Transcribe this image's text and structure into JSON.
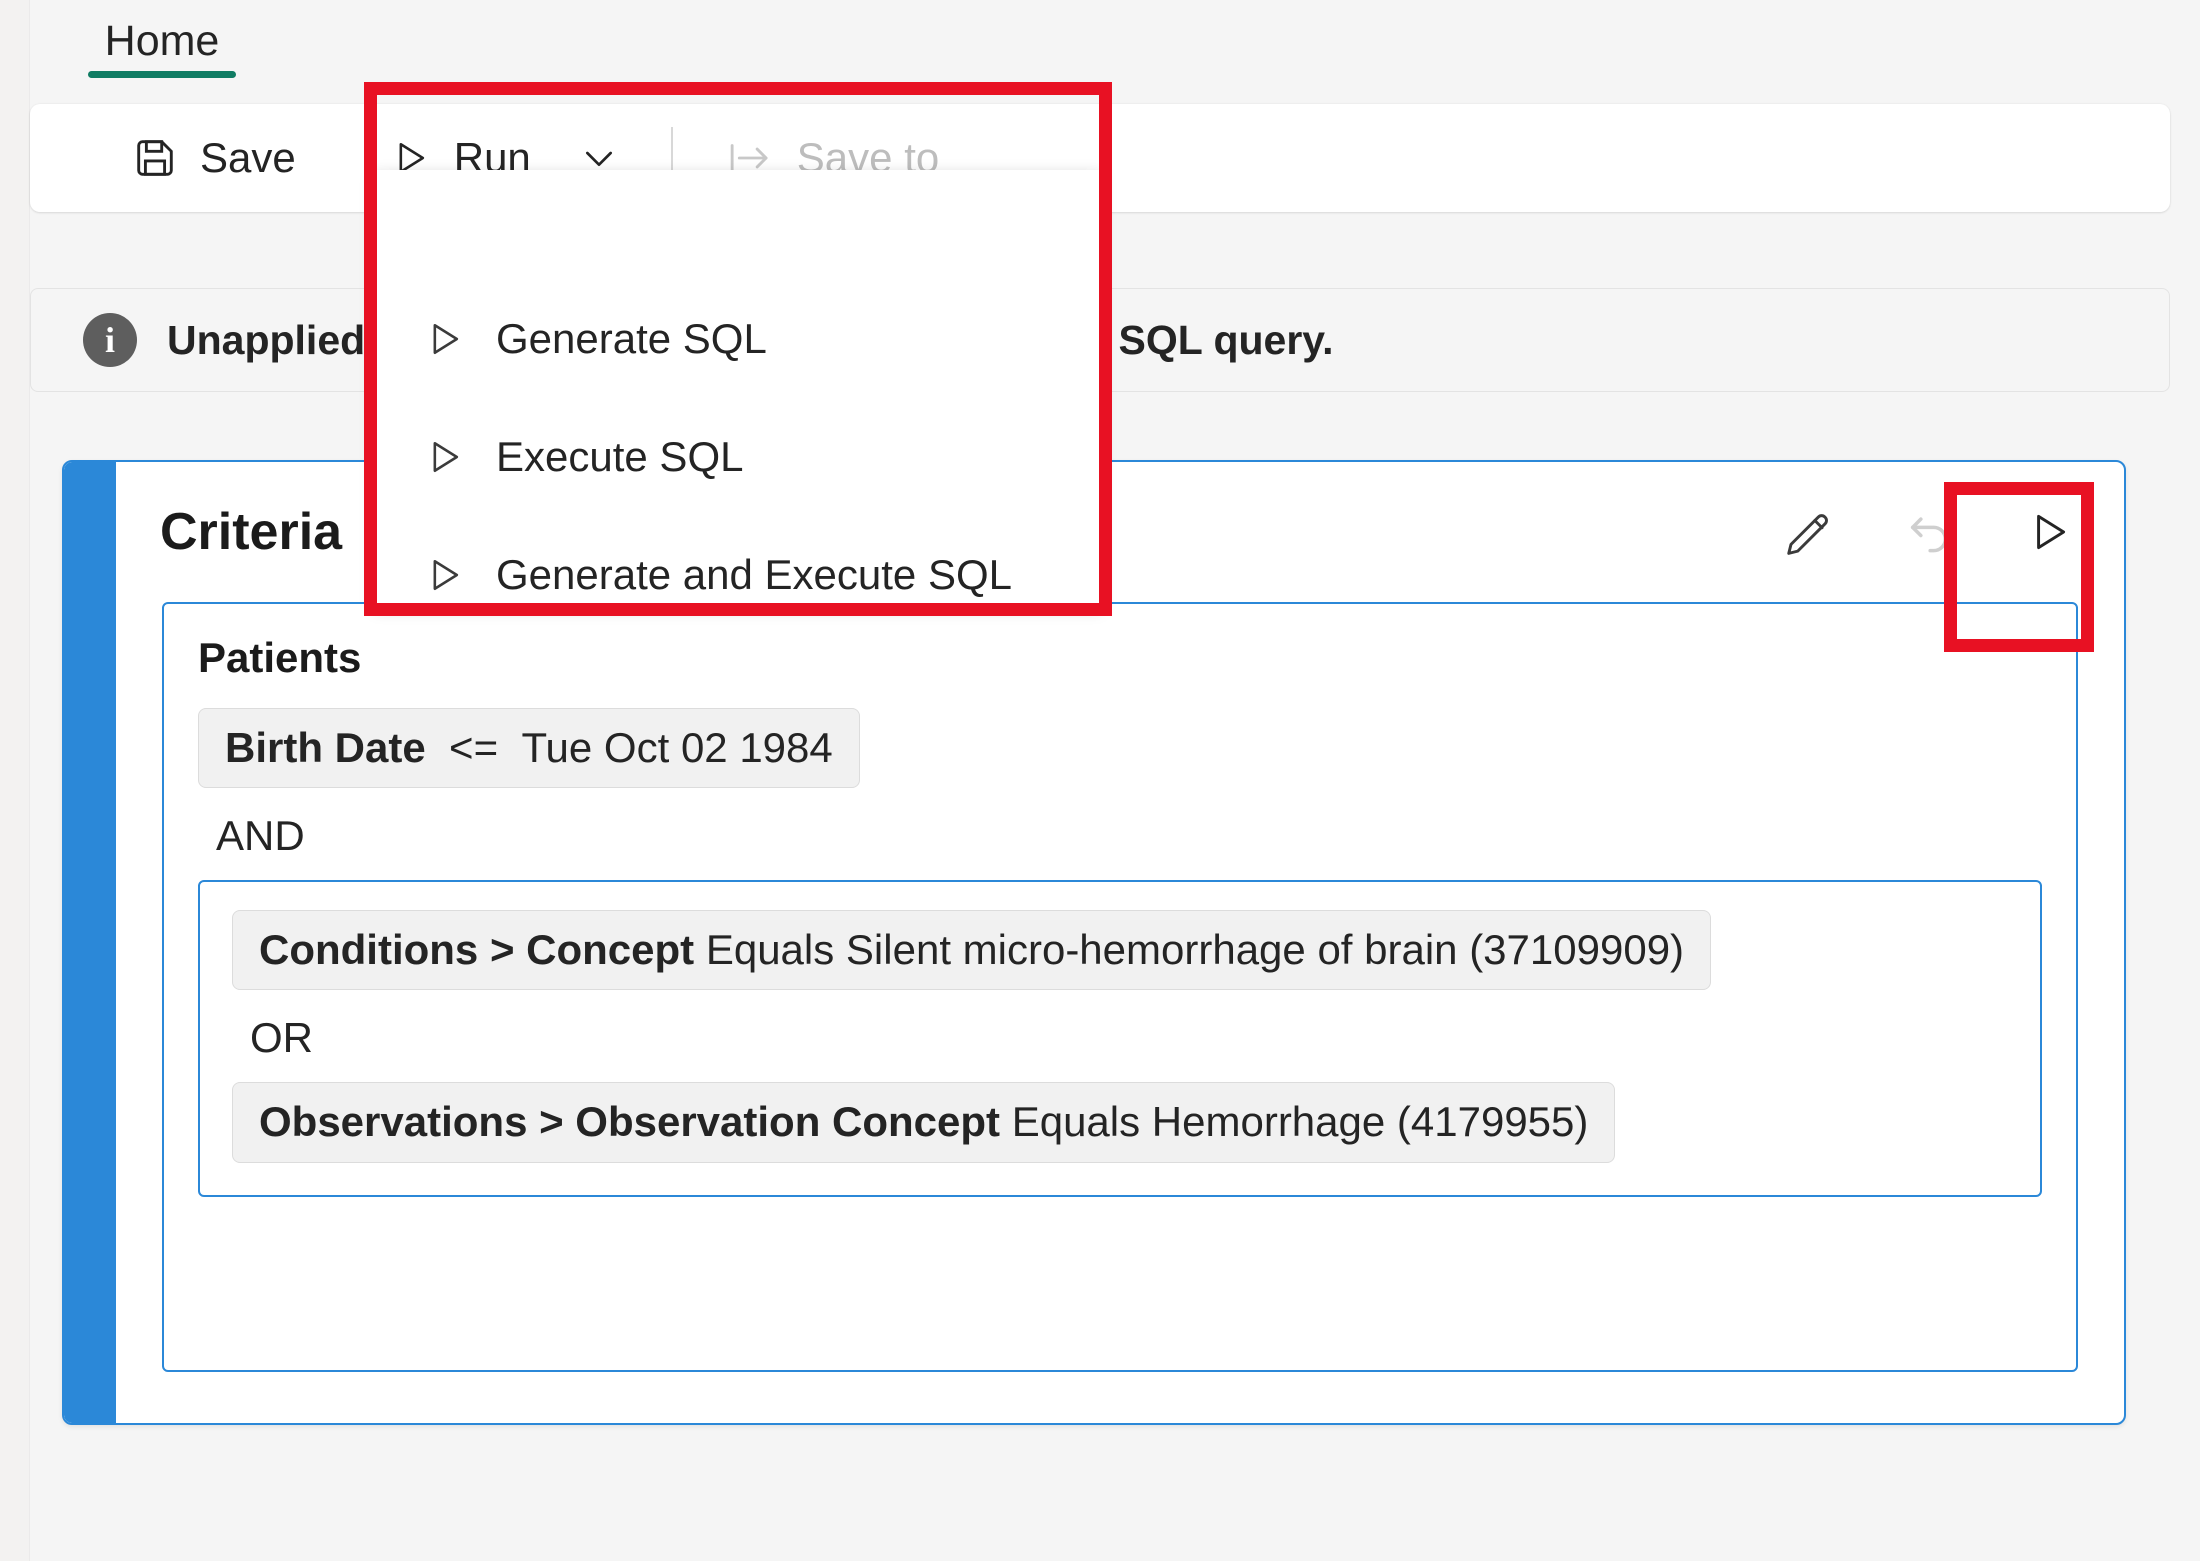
{
  "tabs": [
    {
      "label": "Home",
      "active": true
    }
  ],
  "toolbar": {
    "save_label": "Save",
    "save_icon": "floppy-disk-icon",
    "run_label": "Run",
    "run_icon": "play-triangle-icon",
    "run_chevron_icon": "chevron-down-icon",
    "save_to_label": "Save to",
    "save_to_icon": "save-to-arrow-icon",
    "save_to_disabled": true
  },
  "message_bar": {
    "icon": "info-circle-icon",
    "icon_glyph": "i",
    "bold_prefix": "Unapplied",
    "text": "Unapplied changes. Generate SQL to update the SQL query."
  },
  "run_menu": {
    "open": true,
    "items": [
      {
        "label": "Generate SQL",
        "icon": "play-triangle-icon"
      },
      {
        "label": "Execute SQL",
        "icon": "play-triangle-icon"
      },
      {
        "label": "Generate and Execute SQL",
        "icon": "play-triangle-icon"
      }
    ]
  },
  "card": {
    "title": "Criteria",
    "accent_color": "#2b88d8",
    "actions": [
      {
        "name": "edit-button",
        "icon": "pencil-icon",
        "disabled": false
      },
      {
        "name": "undo-button",
        "icon": "undo-arrow-icon",
        "disabled": true
      },
      {
        "name": "run-button",
        "icon": "play-triangle-icon",
        "disabled": false
      }
    ]
  },
  "query_builder": {
    "entity": "Patients",
    "criteria_1": {
      "field": "Birth Date",
      "operator": "<=",
      "value": "Tue Oct 02 1984"
    },
    "outer_operator": "AND",
    "group": {
      "inner_operator": "OR",
      "criteria": [
        {
          "field": "Conditions > Concept",
          "operator": "Equals",
          "value": "Silent micro-hemorrhage of brain (37109909)"
        },
        {
          "field": "Observations > Observation Concept",
          "operator": "Equals",
          "value": "Hemorrhage (4179955)"
        }
      ]
    }
  },
  "annotations": {
    "highlight_color": "#e81123",
    "boxes": [
      {
        "name": "run-menu-highlight"
      },
      {
        "name": "card-run-button-highlight"
      }
    ]
  }
}
